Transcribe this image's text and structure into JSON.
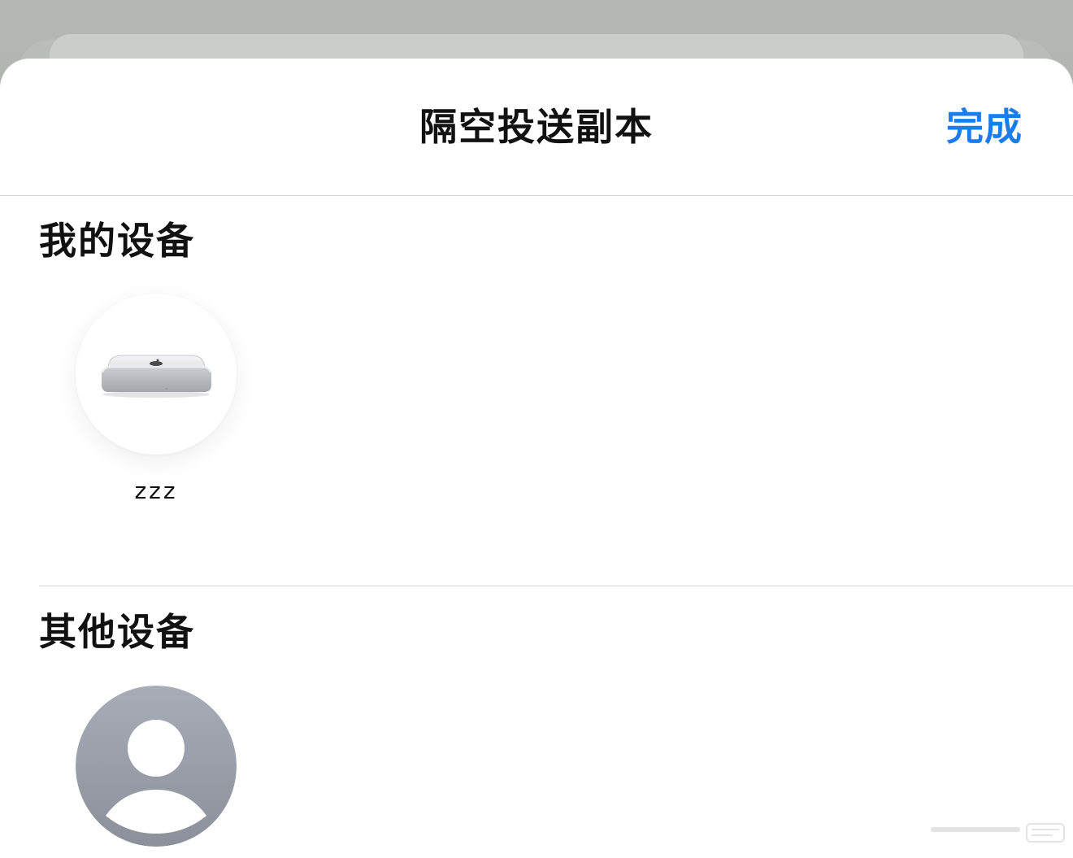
{
  "header": {
    "title": "隔空投送副本",
    "done_label": "完成"
  },
  "sections": {
    "my_devices": {
      "title": "我的设备",
      "devices": [
        {
          "name": "zzz",
          "icon": "mac-mini-icon"
        }
      ]
    },
    "other_devices": {
      "title": "其他设备",
      "devices": [
        {
          "icon": "person-avatar-icon"
        }
      ]
    }
  },
  "colors": {
    "accent": "#1b7cf0",
    "sheet_background": "#ffffff",
    "divider": "#d4d4d6",
    "text_primary": "#111111",
    "avatar_gray": "#9a9ea8"
  }
}
